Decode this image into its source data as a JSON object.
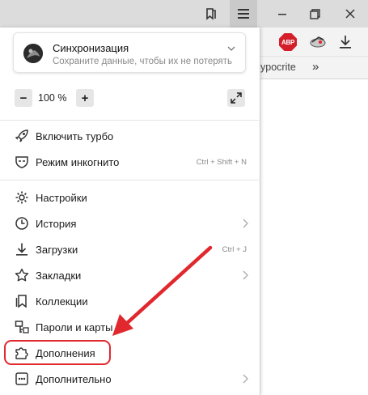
{
  "colors": {
    "highlight": "#e0282e",
    "arrow": "#e0282e",
    "menu_bg": "#ffffff",
    "chrome": "#dcdcdc"
  },
  "toolbar": {
    "icons": [
      "bookmarks-icon",
      "menu-hamburger-icon",
      "minimize-icon",
      "restore-icon",
      "close-icon"
    ],
    "ext_abp": "ABP",
    "bookmark_text": "ypocrite",
    "bookmark_more": "»"
  },
  "sync": {
    "title": "Синхронизация",
    "subtitle": "Сохраните данные, чтобы их не потерять"
  },
  "zoom": {
    "minus": "−",
    "value": "100 %",
    "plus": "+"
  },
  "menu": {
    "items": [
      {
        "label": "Включить турбо",
        "icon": "rocket-icon"
      },
      {
        "label": "Режим инкогнито",
        "icon": "incognito-mask-icon",
        "shortcut": "Ctrl + Shift + N"
      },
      {
        "label": "Настройки",
        "icon": "gear-icon"
      },
      {
        "label": "История",
        "icon": "clock-icon",
        "submenu": true
      },
      {
        "label": "Загрузки",
        "icon": "download-icon",
        "shortcut": "Ctrl + J"
      },
      {
        "label": "Закладки",
        "icon": "star-icon",
        "submenu": true
      },
      {
        "label": "Коллекции",
        "icon": "collections-icon"
      },
      {
        "label": "Пароли и карты",
        "icon": "key-card-icon"
      },
      {
        "label": "Дополнения",
        "icon": "puzzle-icon"
      },
      {
        "label": "Дополнительно",
        "icon": "more-dots-icon",
        "submenu": true
      }
    ]
  }
}
